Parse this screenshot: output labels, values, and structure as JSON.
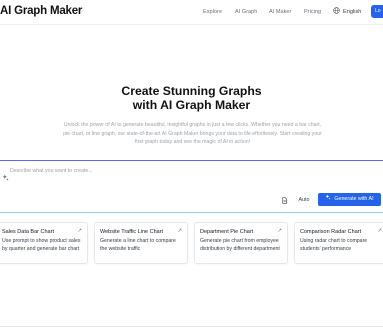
{
  "header": {
    "logo": "AI Graph Maker",
    "nav": [
      "Explore",
      "AI Graph",
      "AI Maker",
      "Pricing"
    ],
    "language": "English",
    "login_label": "Lo"
  },
  "hero": {
    "title_line1": "Create Stunning Graphs",
    "title_line2": "with AI Graph Maker",
    "subtitle": "Unlock the power of AI to generate beautiful, insightful graphs in just a few clicks. Whether you need a bar chart, pie chart, or line graph, our state-of-the-art AI Graph Maker brings your data to life effortlessly. Start creating your first graph today and see the magic of AI in action!"
  },
  "prompt": {
    "placeholder": "Describe what you want to create...",
    "mode": "Auto",
    "generate_label": "Generate with AI"
  },
  "examples": [
    {
      "title": "Sales Data Bar Chart",
      "desc": "Use prompt to show product sales by quarter and generate bar chart"
    },
    {
      "title": "Website Traffic Line Chart",
      "desc": "Generate a line chart to compare the website traffic"
    },
    {
      "title": "Department Pie Chart",
      "desc": "Generate pie chart from employee distribution by different department"
    },
    {
      "title": "Comparison Radar Chart",
      "desc": "Using radar chart to compare students' performance"
    }
  ],
  "colors": {
    "accent": "#2563eb",
    "border_gradient_start": "#6366f1"
  },
  "icons": {
    "language": "globe-icon",
    "prompt": "sparkle-icon",
    "file": "file-icon",
    "generate": "sparkle-icon",
    "card": "arrow-up-right-icon"
  }
}
